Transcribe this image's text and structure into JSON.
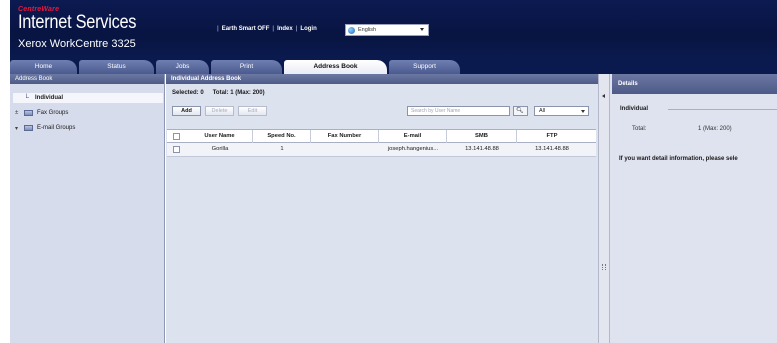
{
  "header": {
    "brand_top": "CentreWare",
    "title": "Internet Services",
    "model": "Xerox WorkCentre 3325",
    "links": [
      "Earth Smart OFF",
      "Index",
      "Login"
    ],
    "language": "English"
  },
  "tabs": [
    {
      "label": "Home",
      "active": false
    },
    {
      "label": "Status",
      "active": false
    },
    {
      "label": "Jobs",
      "active": false
    },
    {
      "label": "Print",
      "active": false
    },
    {
      "label": "Address Book",
      "active": true
    },
    {
      "label": "Support",
      "active": false
    }
  ],
  "left_panel": {
    "title": "Address Book",
    "items": [
      {
        "label": "Individual",
        "selected": true
      },
      {
        "label": "Fax Groups",
        "selected": false
      },
      {
        "label": "E-mail Groups",
        "selected": false
      }
    ]
  },
  "main_panel": {
    "title": "Individual Address Book",
    "selected_label": "Selected: 0",
    "total_label": "Total: 1 (Max: 200)",
    "buttons": {
      "add": "Add",
      "delete": "Delete",
      "edit": "Edit"
    },
    "search_placeholder": "Search by User Name",
    "filter_value": "All",
    "columns": [
      "User Name",
      "Speed No.",
      "Fax Number",
      "E-mail",
      "SMB",
      "FTP"
    ],
    "rows": [
      {
        "user_name": "Gorilla",
        "speed_no": "1",
        "fax_number": "",
        "email": "joseph.hangenius...",
        "smb": "13.141.48.88",
        "ftp": "13.141.48.88"
      }
    ]
  },
  "details": {
    "title": "Details",
    "section": "Individual",
    "total_label": "Total:",
    "total_value": "1 (Max: 200)",
    "info": "If you want detail information, please sele"
  }
}
